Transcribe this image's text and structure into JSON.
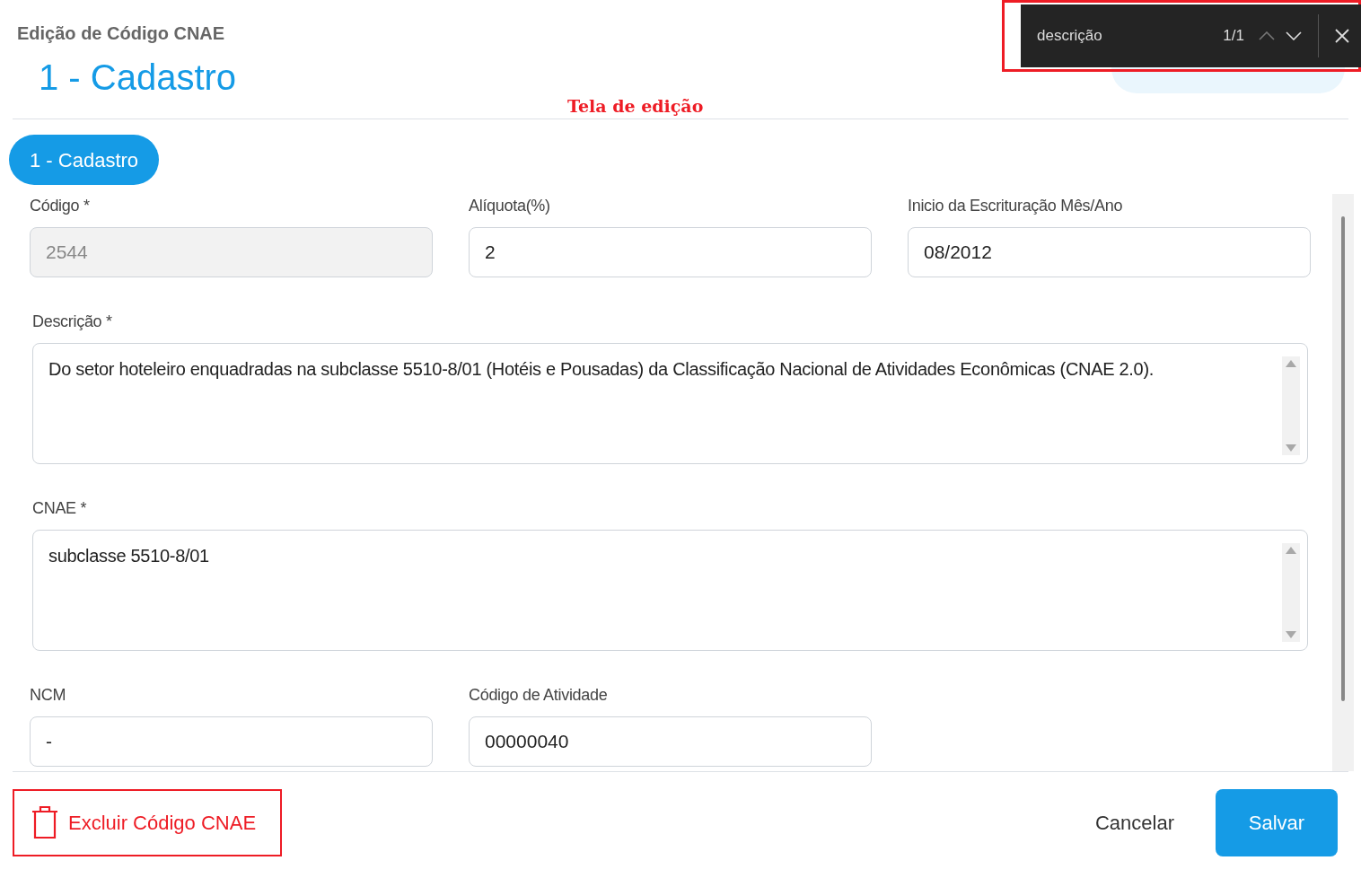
{
  "header": {
    "subtitle": "Edição de Código CNAE",
    "title": "1 - Cadastro",
    "annotation": "Tela de edição"
  },
  "find_bar": {
    "query": "descrição",
    "count": "1/1",
    "highlighted": true
  },
  "tabs": [
    {
      "label": "1 - Cadastro",
      "selected": true
    }
  ],
  "fields": [
    {
      "label": "Código *",
      "value": "2544",
      "kind": "input",
      "disabled": true
    },
    {
      "label": "Alíquota(%)",
      "value": "2",
      "kind": "input",
      "disabled": false
    },
    {
      "label": "Inicio da Escrituração Mês/Ano",
      "value": "08/2012",
      "kind": "input",
      "disabled": false
    },
    {
      "label": "Descrição *",
      "value": "Do setor hoteleiro enquadradas na subclasse 5510-8/01 (Hotéis e Pousadas) da Classificação Nacional de Atividades Econômicas (CNAE 2.0).",
      "kind": "textarea",
      "disabled": false
    },
    {
      "label": "CNAE *",
      "value": "subclasse 5510-8/01",
      "kind": "textarea",
      "disabled": false
    },
    {
      "label": "NCM",
      "value": "-",
      "kind": "input",
      "disabled": false
    },
    {
      "label": "Código de Atividade",
      "value": "00000040",
      "kind": "input",
      "disabled": false
    }
  ],
  "footer": {
    "delete": "Excluir Código CNAE",
    "delete_highlighted": true,
    "cancel": "Cancelar",
    "save": "Salvar"
  }
}
